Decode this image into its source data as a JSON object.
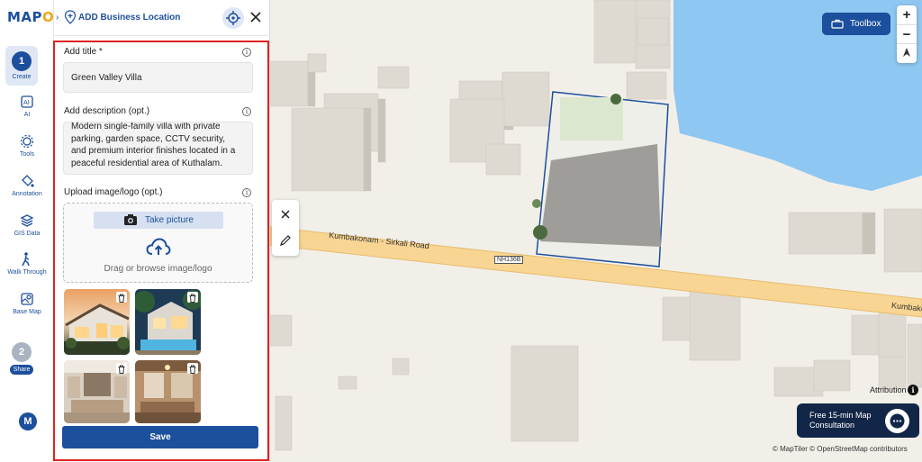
{
  "app": {
    "logo_main": "MAP",
    "logo_accent": "O",
    "logo_tail": "G"
  },
  "rail": {
    "steps": [
      {
        "number": "1",
        "label": "Create"
      },
      {
        "number": "2",
        "label": "Share"
      }
    ],
    "items": [
      {
        "label": "AI",
        "icon": "ai-icon"
      },
      {
        "label": "Tools",
        "icon": "gear-icon"
      },
      {
        "label": "Annotation",
        "icon": "paint-bucket-icon"
      },
      {
        "label": "GIS Data",
        "icon": "layers-icon"
      },
      {
        "label": "Walk Through",
        "icon": "walk-icon"
      },
      {
        "label": "Base Map",
        "icon": "map-icon"
      }
    ],
    "avatar": "M"
  },
  "panel": {
    "title": "ADD Business Location",
    "title_label": "Add title *",
    "title_value": "Green Valley Villa",
    "description_label": "Add description (opt.)",
    "description_value": "Modern single-family villa with private parking, garden space, CCTV security, and premium interior finishes located in a peaceful residential area of Kuthalam.",
    "upload_label": "Upload image/logo (opt.)",
    "take_picture": "Take picture",
    "browse_text": "Drag or browse image/logo",
    "info_glyph": "i",
    "save_label": "Save"
  },
  "map": {
    "toolbox_label": "Toolbox",
    "zoom_in": "+",
    "zoom_out": "−",
    "road_name": "Kumbakonam - Sirkali Road",
    "road_name_short": "Kumbako",
    "road_shield": "NH136B",
    "attribution": "Attribution",
    "consult_text": "Free 15-min Map Consultation",
    "copyright": "© MapTiler © OpenStreetMap contributors"
  },
  "colors": {
    "brand": "#1c4f9c",
    "accent": "#f2a51a",
    "highlight_border": "#e02020",
    "water": "#8ec7f1",
    "road": "#f8d592"
  }
}
